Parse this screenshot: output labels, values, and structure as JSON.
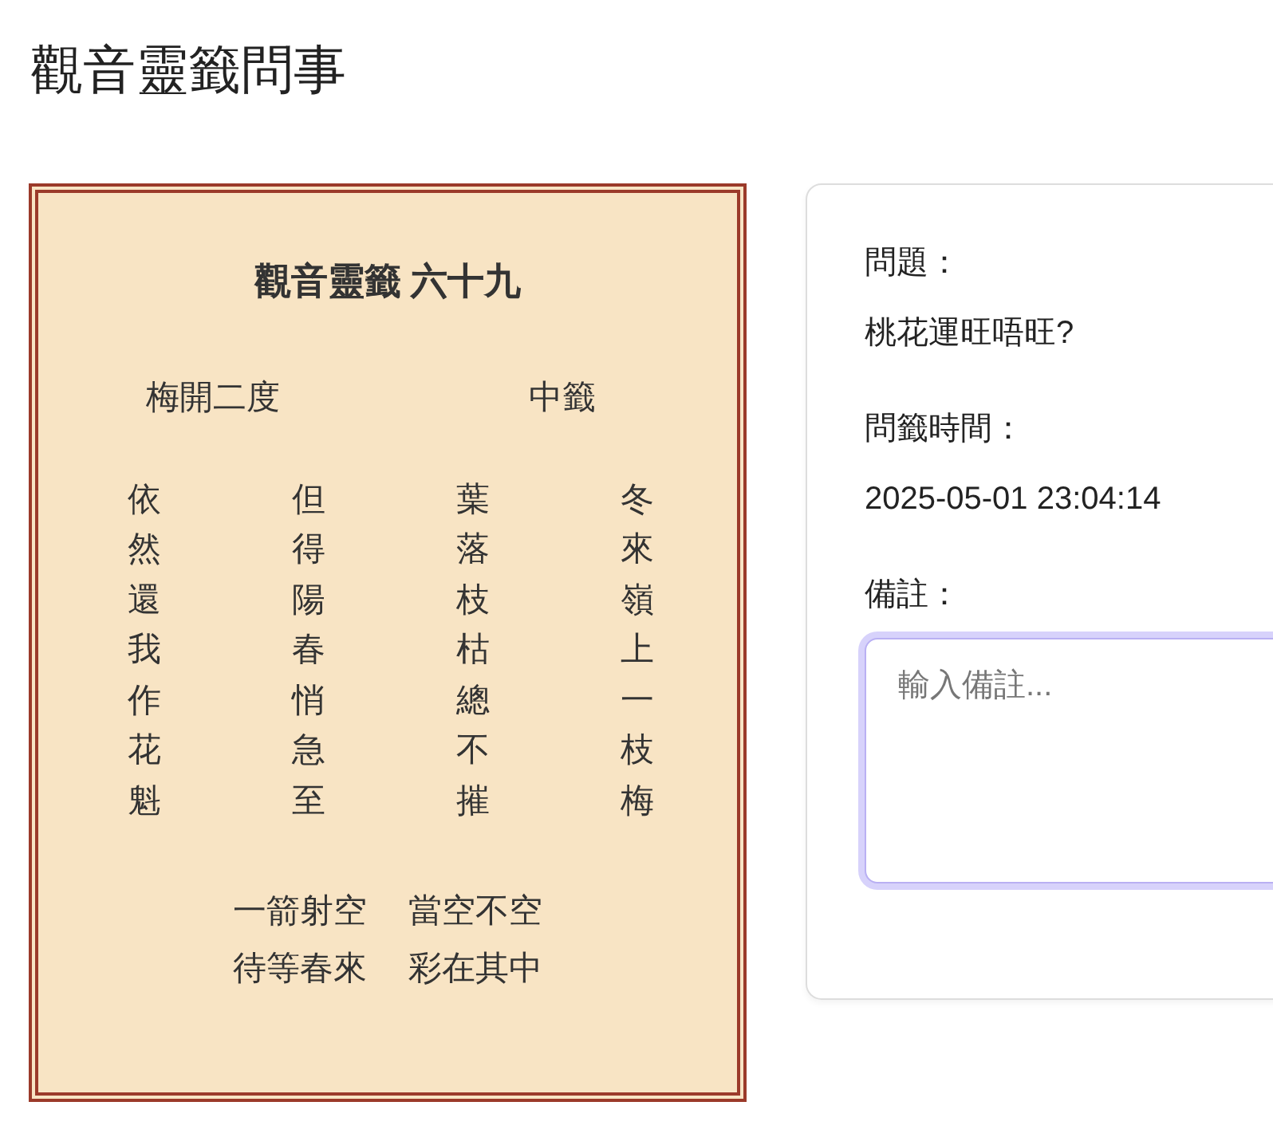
{
  "page_title": "觀音靈籤問事",
  "lot": {
    "title": "觀音靈籤 六十九",
    "name": "梅開二度",
    "grade": "中籤",
    "poem_columns": [
      "依然還我作花魁",
      "但得陽春悄急至",
      "葉落枝枯總不摧",
      "冬來嶺上一枝梅"
    ],
    "verse_lines": [
      [
        "一箭射空",
        "當空不空"
      ],
      [
        "待等春來",
        "彩在其中"
      ]
    ]
  },
  "details": [
    {
      "label": "問題：",
      "value": "桃花運旺唔旺?"
    },
    {
      "label": "問籤時間：",
      "value": "2025-05-01 23:04:14"
    }
  ],
  "note": {
    "label": "備註：",
    "placeholder": "輸入備註...",
    "focused": true
  }
}
